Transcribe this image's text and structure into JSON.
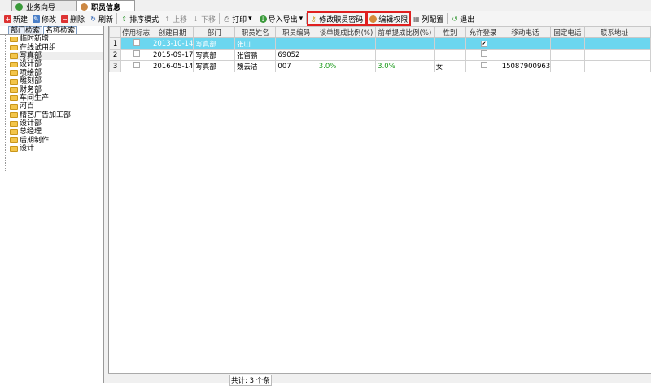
{
  "tabs": [
    {
      "label": "业务向导",
      "icon": "guide-icon"
    },
    {
      "label": "职员信息",
      "icon": "staff-icon"
    }
  ],
  "toolbar": {
    "new": "新建",
    "edit": "修改",
    "delete": "删除",
    "refresh": "刷新",
    "sort_mode": "排序模式",
    "move_up": "上移",
    "move_down": "下移",
    "print": "打印",
    "import_export": "导入导出",
    "change_password": "修改职员密码",
    "edit_permissions": "编辑权限",
    "column_config": "列配置",
    "exit": "退出"
  },
  "left": {
    "tabs": [
      "部门检索",
      "名称检索"
    ],
    "departments": [
      "临时新增",
      "在线试用组",
      "写真部",
      "设计部",
      "喷绘部",
      "雕刻部",
      "财务部",
      "车间生产",
      "河百",
      "精艺广告加工部",
      "设计部",
      "总经理",
      "后期制作",
      "设计"
    ],
    "selected": "写真部"
  },
  "grid": {
    "columns": [
      "停用标志",
      "创建日期",
      "部门",
      "职员姓名",
      "职员编码",
      "谈单提成比例(%)",
      "前单提成比例(%)",
      "性别",
      "允许登录",
      "移动电话",
      "固定电话",
      "联系地址",
      ""
    ],
    "rows": [
      {
        "num": "1",
        "disabled": false,
        "created": "2013-10-14",
        "dept": "写真部",
        "name": "张山",
        "code": "",
        "talk": "",
        "front": "",
        "gender": "",
        "login": true,
        "mobile": "",
        "phone": "",
        "address": ""
      },
      {
        "num": "2",
        "disabled": false,
        "created": "2015-09-17",
        "dept": "写真部",
        "name": "张留鹏",
        "code": "69052",
        "talk": "",
        "front": "",
        "gender": "",
        "login": false,
        "mobile": "",
        "phone": "",
        "address": ""
      },
      {
        "num": "3",
        "disabled": false,
        "created": "2016-05-14",
        "dept": "写真部",
        "name": "魏云洁",
        "code": "007",
        "talk": "3.0%",
        "front": "3.0%",
        "gender": "女",
        "login": false,
        "mobile": "15087900963",
        "phone": "",
        "address": ""
      }
    ],
    "selected_row": 1
  },
  "footer": {
    "total": "共计: 3 个条"
  },
  "colors": {
    "selected_row": "#6cd6ef",
    "highlight": "#e02020"
  }
}
